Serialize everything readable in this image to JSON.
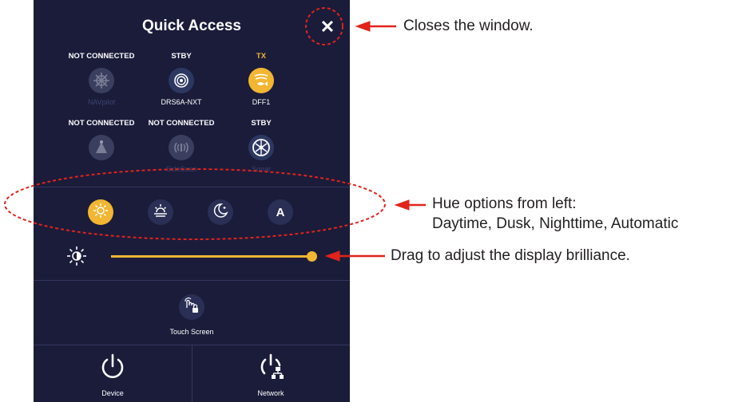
{
  "panel": {
    "title": "Quick Access",
    "close_glyph": "✕"
  },
  "devices": [
    {
      "status": "NOT CONNECTED",
      "name": "NAVpilot",
      "icon": "helm-wheel-icon",
      "state": "not-connected"
    },
    {
      "status": "STBY",
      "name": "DRS6A-NXT",
      "icon": "radar-icon",
      "state": "standby"
    },
    {
      "status": "TX",
      "name": "DFF1",
      "icon": "fish-finder-icon",
      "state": "transmitting"
    },
    {
      "status": "NOT CONNECTED",
      "name": "",
      "icon": "sonar-beam-icon",
      "state": "not-connected"
    },
    {
      "status": "NOT CONNECTED",
      "name": "SideScan",
      "icon": "side-scan-icon",
      "state": "not-connected"
    },
    {
      "status": "STBY",
      "name": "Sonar",
      "icon": "sonar-icon",
      "state": "standby"
    }
  ],
  "hue_options": [
    {
      "key": "daytime",
      "icon": "sun-icon",
      "active": true
    },
    {
      "key": "dusk",
      "icon": "sunset-icon",
      "active": false
    },
    {
      "key": "nighttime",
      "icon": "moon-icon",
      "active": false
    },
    {
      "key": "automatic",
      "icon": "auto-icon",
      "label": "A",
      "active": false
    }
  ],
  "brilliance": {
    "icon": "brightness-icon",
    "level": 1.0
  },
  "touch_screen": {
    "label": "Touch Screen",
    "icon": "touch-lock-icon"
  },
  "footer": {
    "device_label": "Device",
    "network_label": "Network"
  },
  "annotations": {
    "close": "Closes the window.",
    "hue_line1": "Hue options from left:",
    "hue_line2": "Daytime, Dusk, Nighttime, Automatic",
    "brilliance": "Drag to adjust the display brilliance."
  },
  "colors": {
    "panel_bg": "#1a1c3a",
    "accent": "#f2b632",
    "callout_red": "#e2231a"
  }
}
